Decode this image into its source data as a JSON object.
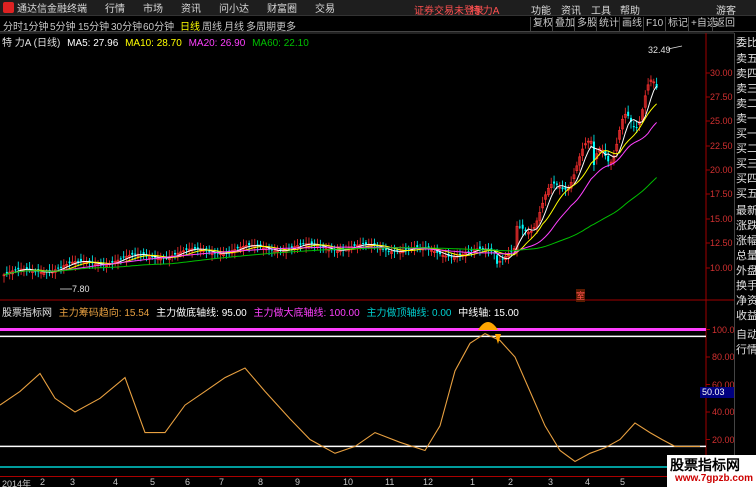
{
  "titlebar": {
    "app_title": "通达信金融终端",
    "menus": [
      "行情",
      "市场",
      "资讯",
      "问小达",
      "财富圈",
      "交易"
    ],
    "login_status": "证券交易未登录",
    "stock_name": "特 力A",
    "right_menus": [
      "功能",
      "资讯",
      "工具",
      "帮助"
    ],
    "user": "游客"
  },
  "toolbar": {
    "periods": [
      "分时",
      "1分钟",
      "5分钟",
      "15分钟",
      "30分钟",
      "60分钟",
      "日线",
      "周线",
      "月线",
      "多周期",
      "更多"
    ],
    "active_period": "日线",
    "right_buttons": [
      "复权",
      "叠加",
      "多股",
      "统计",
      "画线",
      "F10",
      "标记",
      "+自选",
      "返回"
    ]
  },
  "main_info": {
    "stock": "特 力A (日线)",
    "ma5": "MA5: 27.96",
    "ma10": "MA10: 28.70",
    "ma20": "MA20: 26.90",
    "ma60": "MA60: 22.10"
  },
  "price_axis": [
    "30.00",
    "27.50",
    "25.00",
    "22.50",
    "20.00",
    "17.50",
    "15.00",
    "12.50",
    "10.00"
  ],
  "annotations": {
    "high": "32.49",
    "low": "7.80",
    "weight_mark": "室"
  },
  "indicator_info": {
    "name": "股票指标网",
    "l1": "主力筹码趋向: 15.54",
    "l2": "主力做底轴线: 95.00",
    "l3": "主力做大底轴线: 100.00",
    "l4": "主力做顶轴线: 0.00",
    "l5": "中线轴: 15.00"
  },
  "indicator_axis": [
    "100.00",
    "80.00",
    "60.00",
    "40.00",
    "20.00"
  ],
  "indicator_current": "50.03",
  "right_panel": [
    "委比",
    "卖五",
    "卖四",
    "卖三",
    "卖二",
    "卖一",
    "买一",
    "买二",
    "买三",
    "买四",
    "买五",
    "最新",
    "涨跌",
    "涨幅",
    "总量",
    "外盘",
    "换手",
    "净资",
    "收益",
    "自动",
    "行情"
  ],
  "date_axis": [
    "2014年",
    "2",
    "3",
    "4",
    "5",
    "6",
    "7",
    "8",
    "9",
    "10",
    "11",
    "12",
    "1",
    "2",
    "3",
    "4",
    "5"
  ],
  "watermark": {
    "line1": "股票指标网",
    "line2": "www.7gpzb.com"
  },
  "colors": {
    "ma5": "#ffffff",
    "ma10": "#ffff00",
    "ma20": "#ff40ff",
    "ma60": "#00c000",
    "indicator": "#e8a040",
    "up": "#ff3030",
    "down": "#00ffff"
  }
}
